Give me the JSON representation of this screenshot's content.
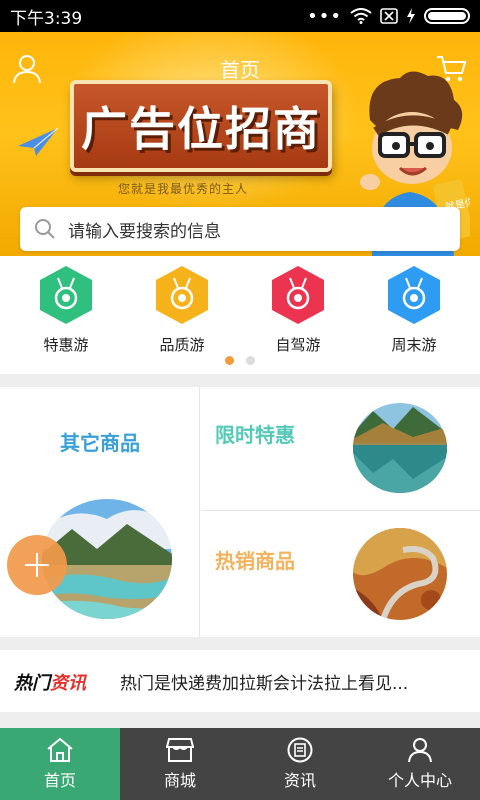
{
  "status_bar": {
    "time": "下午3:39"
  },
  "header": {
    "title": "首页"
  },
  "banner": {
    "ad_text": "广告位招商",
    "tagline": "您就是我最优秀的主人",
    "sign_badge": "就是你"
  },
  "search": {
    "placeholder": "请输入要搜索的信息"
  },
  "categories": [
    {
      "label": "特惠游",
      "color": "#2fbf7e",
      "icon": "medal-icon"
    },
    {
      "label": "品质游",
      "color": "#f5b21b",
      "icon": "medal-icon"
    },
    {
      "label": "自驾游",
      "color": "#ec3350",
      "icon": "medal-icon"
    },
    {
      "label": "周末游",
      "color": "#2e9cf2",
      "icon": "medal-icon"
    }
  ],
  "carousel": {
    "active_page": 1,
    "pages": 2
  },
  "products": {
    "left_title": "其它商品",
    "top_right_title": "限时特惠",
    "bottom_right_title": "热销商品"
  },
  "news": {
    "logo_part1": "热门",
    "logo_part2": "资讯",
    "headline": "热门是快递费加拉斯会计法拉上看见..."
  },
  "tabbar": [
    {
      "label": "首页",
      "icon": "home-icon",
      "active": true
    },
    {
      "label": "商城",
      "icon": "store-icon",
      "active": false
    },
    {
      "label": "资讯",
      "icon": "news-icon",
      "active": false
    },
    {
      "label": "个人中心",
      "icon": "person-icon",
      "active": false
    }
  ],
  "colors": {
    "accent_green": "#3aa874",
    "accent_orange": "#f39a3a"
  }
}
